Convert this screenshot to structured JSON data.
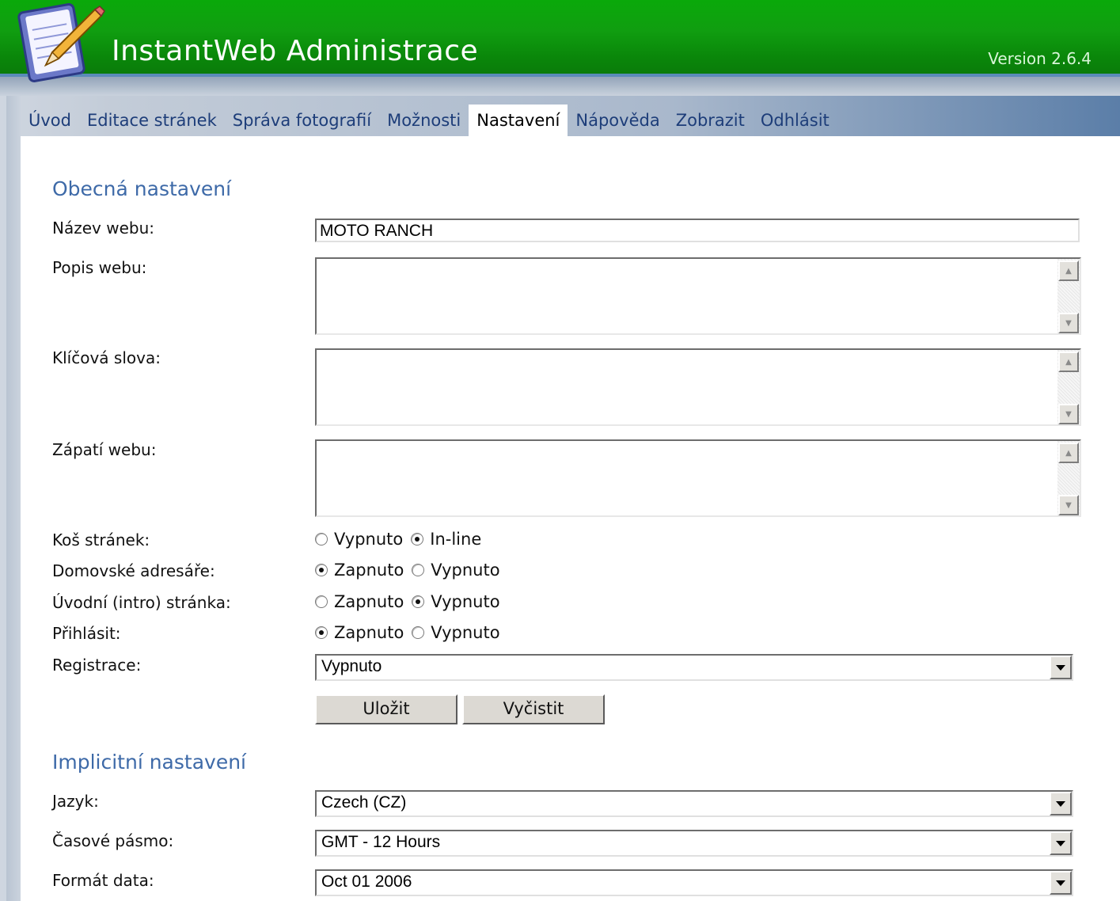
{
  "header": {
    "app_name": "InstantWeb",
    "app_suffix": "Administrace",
    "version": "Version 2.6.4"
  },
  "nav": [
    {
      "label": "Úvod"
    },
    {
      "label": "Editace stránek"
    },
    {
      "label": "Správa fotografií"
    },
    {
      "label": "Možnosti"
    },
    {
      "label": "Nastavení"
    },
    {
      "label": "Nápověda"
    },
    {
      "label": "Zobrazit"
    },
    {
      "label": "Odhlásit"
    }
  ],
  "general": {
    "title": "Obecná nastavení",
    "site_name_label": "Název webu:",
    "site_name_value": "MOTO RANCH",
    "site_desc_label": "Popis webu:",
    "keywords_label": "Klíčová slova:",
    "footer_label": "Zápatí webu:",
    "trash_label": "Koš stránek:",
    "home_dirs_label": "Domovské adresáře:",
    "intro_label": "Úvodní (intro) stránka:",
    "login_label": "Přihlásit:",
    "registration_label": "Registrace:",
    "registration_value": "Vypnuto",
    "opt_off": "Vypnuto",
    "opt_on": "Zapnuto",
    "opt_inline": "In-line",
    "save": "Uložit",
    "clear": "Vyčistit"
  },
  "defaults": {
    "title": "Implicitní nastavení",
    "language_label": "Jazyk:",
    "language_value": "Czech (CZ)",
    "timezone_label": "Časové pásmo:",
    "timezone_value": "GMT - 12 Hours",
    "date_format_label": "Formát data:",
    "date_format_value": "Oct 01 2006"
  }
}
